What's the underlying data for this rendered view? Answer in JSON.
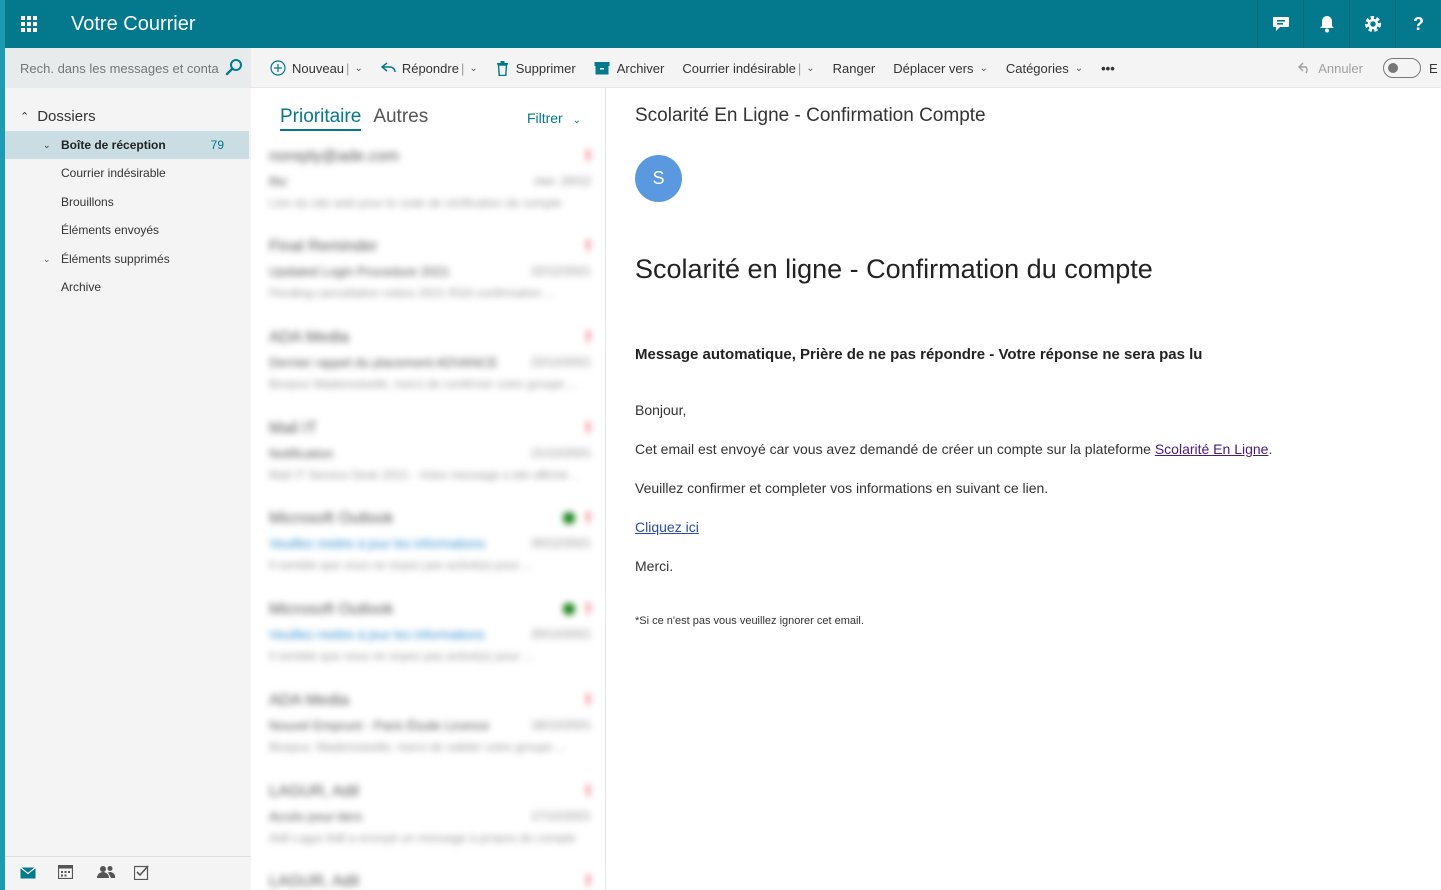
{
  "app": {
    "title": "Votre Courrier"
  },
  "topbar": {
    "icons": [
      "chat-icon",
      "bell-icon",
      "gear-icon",
      "help-icon"
    ],
    "help_label": "?"
  },
  "search": {
    "placeholder": "Rech. dans les messages et conta..."
  },
  "toolbar": {
    "new_label": "Nouveau",
    "reply_label": "Répondre",
    "delete_label": "Supprimer",
    "archive_label": "Archiver",
    "junk_label": "Courrier indésirable",
    "sweep_label": "Ranger",
    "move_label": "Déplacer vers",
    "categories_label": "Catégories",
    "more_label": "•••",
    "undo_label": "Annuler",
    "right_cut_label": "E"
  },
  "folders": {
    "heading": "Dossiers",
    "items": [
      {
        "label": "Boîte de réception",
        "count": "79"
      },
      {
        "label": "Courrier indésirable"
      },
      {
        "label": "Brouillons"
      },
      {
        "label": "Éléments envoyés"
      },
      {
        "label": "Éléments supprimés"
      },
      {
        "label": "Archive"
      }
    ]
  },
  "list": {
    "tab_focused": "Prioritaire",
    "tab_other": "Autres",
    "filter_label": "Filtrer",
    "messages": [
      {
        "sender": "noreply@ade.com",
        "subject": "Re:",
        "date": "mer. 20/12",
        "preview": "Lien du site web pour le code de vérification de compte",
        "flag": "!",
        "dot": false
      },
      {
        "sender": "Final Reminder",
        "subject": "Updated Login Procedure 2021",
        "date": "22/12/2021",
        "preview": "Pending cancellation notice 2021 RSA confirmation ...",
        "flag": "!",
        "dot": false
      },
      {
        "sender": "ADA Media",
        "subject": "Dernier rappel du placement ADVANCE",
        "date": "22/12/2021",
        "preview": "Bonjour Mademoiselle, merci de confirmer votre groupe ...",
        "flag": "!",
        "dot": false
      },
      {
        "sender": "Mail IT",
        "subject": "Notification",
        "date": "21/12/2021",
        "preview": "Mail IT Service Desk 2021 - Votre message a été affiché ...",
        "flag": "!",
        "dot": false
      },
      {
        "sender": "Microsoft Outlook",
        "subject": "Veuillez mettre à jour les informations",
        "date": "20/12/2021",
        "preview": "Il semble que vous ne soyez pas activé(e) pour ...",
        "flag": "!",
        "dot": true
      },
      {
        "sender": "Microsoft Outlook",
        "subject": "Veuillez mettre à jour les informations",
        "date": "20/12/2021",
        "preview": "Il semble que vous ne soyez pas activé(e) pour ...",
        "flag": "!",
        "dot": true
      },
      {
        "sender": "ADA Media",
        "subject": "Nouvel Emprunt - Paris Étude Licence",
        "date": "18/12/2021",
        "preview": "Bonjour, Mademoiselle, merci de valider votre groupe ...",
        "flag": "!",
        "dot": false
      },
      {
        "sender": "LAGUR, Adil",
        "subject": "Accès pour tiers",
        "date": "17/12/2021",
        "preview": "Adil Lagur Adil a envoyé un message à propos du compte ...",
        "flag": "!",
        "dot": false
      },
      {
        "sender": "LAGUR, Adil",
        "subject": "",
        "date": "",
        "preview": "",
        "flag": "!",
        "dot": false
      }
    ]
  },
  "reading": {
    "subject": "Scolarité En Ligne - Confirmation Compte",
    "avatar_letter": "S",
    "heading": "Scolarité en ligne - Confirmation du compte",
    "auto_notice": "Message automatique, Prière de ne pas répondre - Votre réponse ne sera pas lu",
    "greeting": "Bonjour,",
    "line1_before": "Cet email est envoyé car vous avez demandé de créer un compte sur la plateforme ",
    "line1_link": "Scolarité En Ligne",
    "line1_after": ".",
    "line2": "Veuillez confirmer et completer vos informations en suivant ce lien.",
    "link_label": "Cliquez ici",
    "thanks": "Merci.",
    "footnote": "*Si ce n'est pas vous veuillez ignorer cet email."
  },
  "colors": {
    "brand": "#04788c",
    "link": "#4b1a7a",
    "avatar": "#5a99df",
    "flag": "#e81123"
  }
}
